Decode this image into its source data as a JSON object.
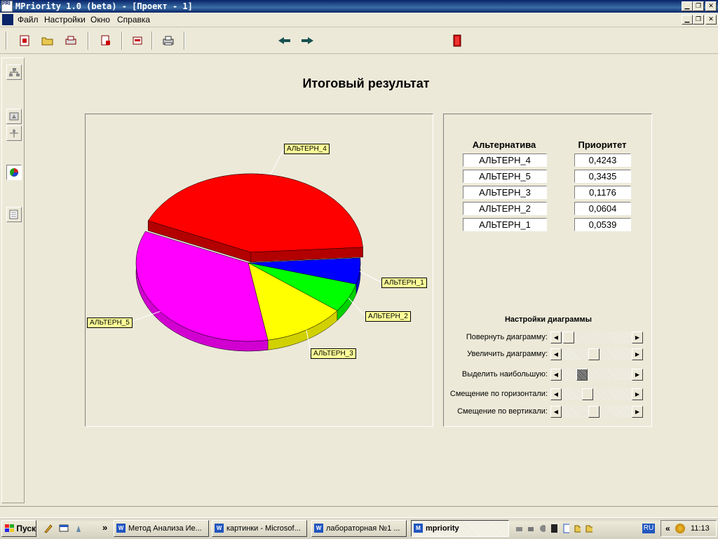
{
  "window": {
    "title": "MPriority 1.0 (beta) - [Проект - 1]",
    "app_icon_text": "PRI"
  },
  "menu": [
    "Файл",
    "Настройки",
    "Окно",
    "Справка"
  ],
  "main": {
    "heading": "Итоговый результат",
    "table": {
      "col_alt": "Альтернатива",
      "col_prio": "Приоритет",
      "rows": [
        {
          "alt": "АЛЬТЕРН_4",
          "prio": "0,4243"
        },
        {
          "alt": "АЛЬТЕРН_5",
          "prio": "0,3435"
        },
        {
          "alt": "АЛЬТЕРН_3",
          "prio": "0,1176"
        },
        {
          "alt": "АЛЬТЕРН_2",
          "prio": "0,0604"
        },
        {
          "alt": "АЛЬТЕРН_1",
          "prio": "0,0539"
        }
      ]
    },
    "settings": {
      "title": "Настройки диаграммы",
      "items": [
        {
          "label": "Повернуть диаграмму:",
          "value": 0.02
        },
        {
          "label": "Увеличить диаграмму:",
          "value": 0.45
        },
        {
          "label": "Выделить наибольшую:",
          "value": 0.25
        },
        {
          "label": "Смещение по горизонтали:",
          "value": 0.35
        },
        {
          "label": "Смещение по вертикали:",
          "value": 0.45
        }
      ]
    }
  },
  "chart_data": {
    "type": "pie",
    "style": "3d-exploded-largest",
    "slices": [
      {
        "label": "АЛЬТЕРН_4",
        "value": 0.4243,
        "color": "#FF0000"
      },
      {
        "label": "АЛЬТЕРН_1",
        "value": 0.0539,
        "color": "#0000FF"
      },
      {
        "label": "АЛЬТЕРН_2",
        "value": 0.0604,
        "color": "#00FF00"
      },
      {
        "label": "АЛЬТЕРН_3",
        "value": 0.1176,
        "color": "#FFFF00"
      },
      {
        "label": "АЛЬТЕРН_5",
        "value": 0.3435,
        "color": "#FF00FF"
      }
    ],
    "label_bg": "#FFFF99"
  },
  "taskbar": {
    "start": "Пуск",
    "tasks": [
      {
        "label": "Метод Анализа Ие...",
        "icon": "word-icon"
      },
      {
        "label": "картинки - Microsof...",
        "icon": "word-icon"
      },
      {
        "label": "лабораторная №1 ...",
        "icon": "word-icon"
      },
      {
        "label": "mpriority",
        "icon": "app-icon",
        "active": true
      }
    ],
    "lang": "RU",
    "clock": "11:13"
  }
}
